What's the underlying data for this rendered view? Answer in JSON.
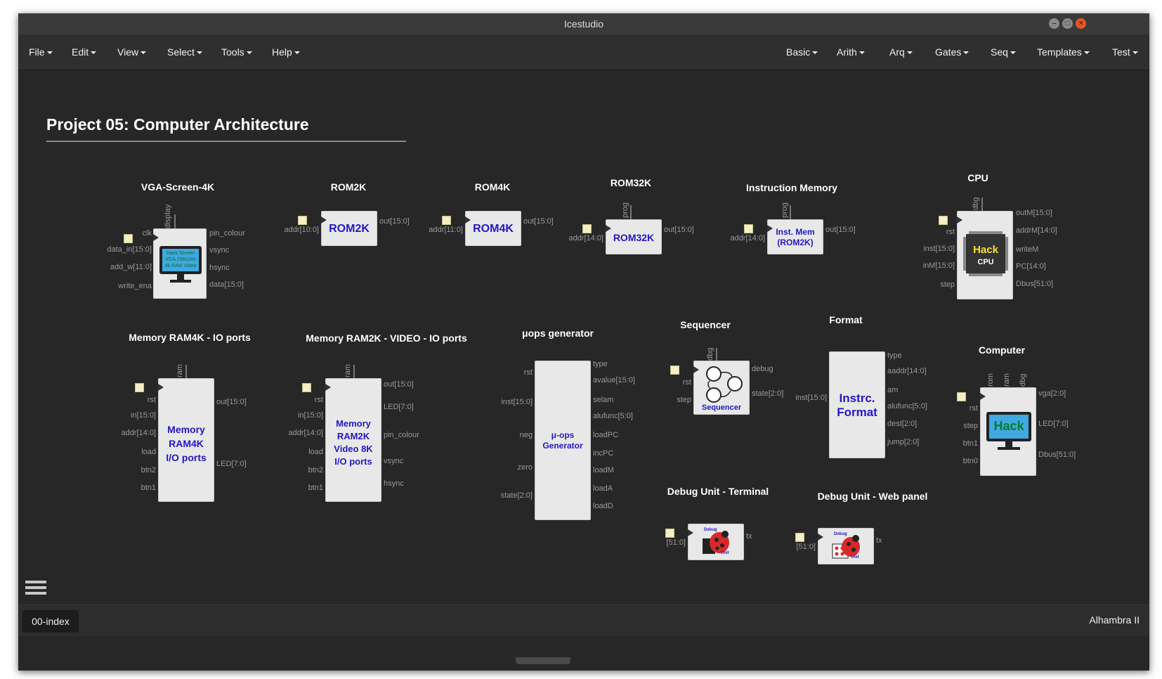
{
  "window": {
    "title": "Icestudio"
  },
  "menu_left": [
    {
      "label": "File"
    },
    {
      "label": "Edit"
    },
    {
      "label": "View"
    },
    {
      "label": "Select"
    },
    {
      "label": "Tools"
    },
    {
      "label": "Help"
    }
  ],
  "menu_right": [
    {
      "label": "Basic"
    },
    {
      "label": "Arith"
    },
    {
      "label": "Arq"
    },
    {
      "label": "Gates"
    },
    {
      "label": "Seq"
    },
    {
      "label": "Templates"
    },
    {
      "label": "Test"
    }
  ],
  "canvas": {
    "title": "Project 05: Computer Architecture"
  },
  "blocks": {
    "vga": {
      "label": "VGA-Screen-4K",
      "screen_text": [
        "Hack Screen",
        "VGA 256x240",
        "4k RAM Video"
      ],
      "top": "display",
      "left": [
        "clk",
        "data_in[15:0]",
        "add_w[11:0]",
        "write_ena"
      ],
      "right": [
        "pin_colour",
        "vsync",
        "hsync",
        "data[15:0]"
      ]
    },
    "rom2k": {
      "label": "ROM2K",
      "text": "ROM2K",
      "left": [
        "addr[10:0]"
      ],
      "right": [
        "out[15:0]"
      ]
    },
    "rom4k": {
      "label": "ROM4K",
      "text": "ROM4K",
      "left": [
        "addr[11:0]"
      ],
      "right": [
        "out[15:0]"
      ]
    },
    "rom32k": {
      "label": "ROM32K",
      "text": "ROM32K",
      "top": "prog",
      "left": [
        "addr[14:0]"
      ],
      "right": [
        "out[15:0]"
      ]
    },
    "imem": {
      "label": "Instruction Memory",
      "text": [
        "Inst. Mem",
        "(ROM2K)"
      ],
      "top": "prog",
      "left": [
        "addr[14:0]"
      ],
      "right": [
        "out[15:0]"
      ]
    },
    "cpu": {
      "label": "CPU",
      "chip_text": [
        "Hack",
        "CPU"
      ],
      "top": "dbg",
      "left": [
        "rst",
        "inst[15:0]",
        "inM[15:0]",
        "step"
      ],
      "right": [
        "outM[15:0]",
        "addrM[14:0]",
        "writeM",
        "PC[14:0]",
        "Dbus[51:0]"
      ]
    },
    "ram4k": {
      "label": "Memory RAM4K - IO ports",
      "text": [
        "Memory",
        "RAM4K",
        "I/O ports"
      ],
      "top": "ram",
      "left": [
        "rst",
        "in[15:0]",
        "addr[14:0]",
        "load",
        "btn2",
        "btn1"
      ],
      "right": [
        "out[15:0]",
        "LED[7:0]"
      ]
    },
    "ram2k": {
      "label": "Memory RAM2K - VIDEO - IO ports",
      "text": [
        "Memory",
        "RAM2K",
        "Video 8K",
        "I/O ports"
      ],
      "top": "ram",
      "left": [
        "rst",
        "in[15:0]",
        "addr[14:0]",
        "load",
        "btn2",
        "btn1"
      ],
      "right": [
        "out[15:0]",
        "LED[7:0]",
        "pin_colour",
        "vsync",
        "hsync"
      ]
    },
    "uops": {
      "label": "μops generator",
      "text": [
        "μ-ops",
        "Generator"
      ],
      "left": [
        "rst",
        "inst[15:0]",
        "neg",
        "zero",
        "state[2:0]"
      ],
      "right": [
        "type",
        "avalue[15:0]",
        "selam",
        "alufunc[5:0]",
        "loadPC",
        "incPC",
        "loadM",
        "loadA",
        "loadD"
      ]
    },
    "seq": {
      "label": "Sequencer",
      "text": "Sequencer",
      "top": "dbg",
      "left": [
        "rst",
        "step"
      ],
      "right": [
        "debug",
        "state[2:0]"
      ]
    },
    "format": {
      "label": "Format",
      "text": [
        "Instrc.",
        "Format"
      ],
      "left": [
        "inst[15:0]"
      ],
      "right": [
        "type",
        "aaddr[14:0]",
        "am",
        "alufunc[5:0]",
        "dest[2:0]",
        "jump[2:0]"
      ]
    },
    "computer": {
      "label": "Computer",
      "screen_text": "Hack",
      "top": [
        "rom",
        "ram",
        "dbg"
      ],
      "left": [
        "rst",
        "step",
        "btn1",
        "btn0"
      ],
      "right": [
        "vga[2:0]",
        "LED[7:0]",
        "Dbus[51:0]"
      ]
    },
    "dbgterm": {
      "label": "Debug Unit - Terminal",
      "icon_text": [
        "Debug",
        "Unit"
      ],
      "left": [
        "[51:0]"
      ],
      "right": [
        "tx"
      ]
    },
    "dbgweb": {
      "label": "Debug Unit - Web panel",
      "icon_text": [
        "Debug",
        "Unit"
      ],
      "left": [
        "[51:0]"
      ],
      "right": [
        "tx"
      ]
    }
  },
  "status": {
    "tab": "00-index",
    "board": "Alhambra II"
  },
  "colors": {
    "background": "#272727",
    "block": "#e8e8e8",
    "block_text": "#2416c8",
    "pin_text": "#9a9a9a"
  }
}
